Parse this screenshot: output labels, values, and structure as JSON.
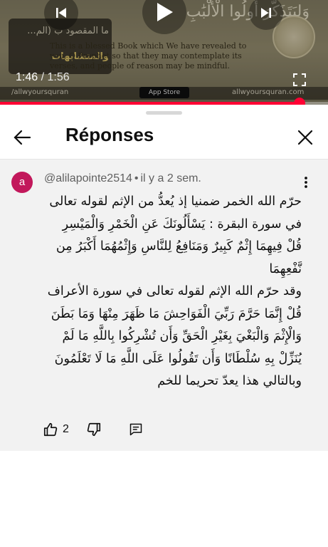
{
  "player": {
    "current_time": "1:46",
    "separator": " / ",
    "duration": "1:56",
    "progress_fraction": 0.914,
    "overlay_arabic": "وَلِيَتَذَكَّرَ أُولُوا الْأَلْبَٰبِ ﴿٢٩﴾",
    "thumb_title": "ما المقصود ب (الم...",
    "thumb_subtitle": "والمتشابهات",
    "translation_text": "This is a blessed Book which We have revealed to you, O Prophet so that they may contemplate its verses, and people of reason may be mindful.",
    "social_handle": "/allwyoursquran",
    "app_store_label": "App Store",
    "website": "allwyoursquran.com"
  },
  "sheet": {
    "title": "Réponses"
  },
  "comment": {
    "avatar_letter": "a",
    "author": "@alilapointe2514",
    "dot": "•",
    "time_ago": "il y a 2 sem.",
    "body_lines": [
      "حرّم الله الخمر ضمنيا إذ يُعدُّ من الإثم لقوله تعالى",
      "في سورة البقرة : يَسْأَلُونَكَ عَنِ الْخَمْرِ وَالْمَيْسِرِ",
      "قُلْ فِيهِمَا إِثْمٌ كَبِيرٌ وَمَنَافِعُ لِلنَّاسِ وَإِثْمُهُمَا أَكْبَرُ مِن",
      "نَّفْعِهِمَا",
      "وقد حرّم الله الإثم لقوله تعالى في سورة الأعراف",
      "قُلْ إِنَّمَا حَرَّمَ رَبِّيَ الْفَوَاحِشَ مَا ظَهَرَ مِنْهَا وَمَا بَطَنَ",
      "وَالْإِثْمَ وَالْبَغْيَ بِغَيْرِ الْحَقِّ وَأَن تُشْرِكُوا بِاللَّهِ مَا لَمْ",
      "يُنَزِّلْ بِهِ سُلْطَانًا وَأَن تَقُولُوا عَلَى اللَّهِ مَا لَا تَعْلَمُونَ",
      "وبالتالي هذا يعدّ تحريما للخم"
    ],
    "like_count": "2"
  },
  "icons": {
    "previous": "skip-previous-icon",
    "play": "play-icon",
    "next": "skip-next-icon",
    "fullscreen": "fullscreen-icon",
    "back": "arrow-back-icon",
    "close": "close-icon",
    "more": "more-vert-icon",
    "like": "thumb-up-icon",
    "dislike": "thumb-down-icon",
    "reply": "reply-comment-icon"
  },
  "colors": {
    "accent": "#ff0033",
    "avatar": "#c2185b",
    "comment_bg": "#f2f2f2"
  }
}
